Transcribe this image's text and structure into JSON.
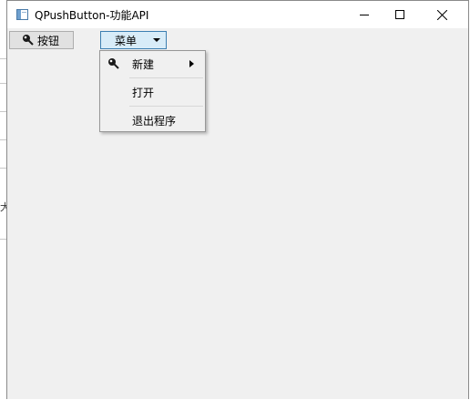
{
  "window": {
    "title": "QPushButton-功能API",
    "controls": {
      "minimize_icon": "minimize-icon",
      "maximize_icon": "maximize-icon",
      "close_icon": "close-icon"
    }
  },
  "background": {
    "glyph": "大"
  },
  "toolbar": {
    "push_button": {
      "label": "按钮",
      "icon": "pin-icon"
    },
    "menu_button": {
      "label": "菜单",
      "icon": "dropdown-arrow-icon"
    }
  },
  "menu": {
    "items": [
      {
        "label": "新建",
        "icon": "pin-icon",
        "has_submenu": true
      },
      {
        "label": "打开",
        "icon": "",
        "has_submenu": false
      },
      {
        "label": "退出程序",
        "icon": "",
        "has_submenu": false
      }
    ]
  },
  "colors": {
    "client_bg": "#f0f0f0",
    "menu_button_hover_bg": "#d8ecf8",
    "menu_button_border": "#3c7fb1"
  }
}
